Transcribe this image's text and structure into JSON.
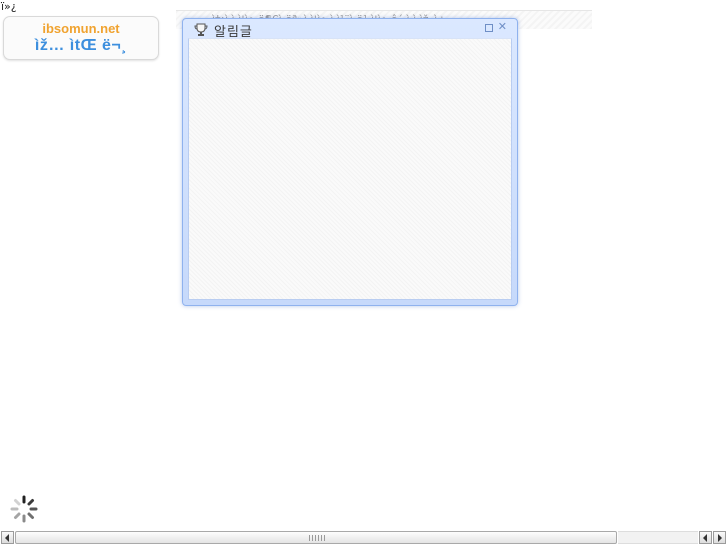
{
  "page": {
    "bom_text": "ï»¿"
  },
  "logo": {
    "site": "ibsomun.net",
    "subtitle": "ìž… ìtŒ ë¬¸"
  },
  "ticker": {
    "text": "ì†¡ì ì  ì¦ì•  ë¶€ì  ëª»ì  ì¦ì•  ì  ì¹¨ì  ë¹ ì¦ì•  ê´ ì  ì  ìž„ì±…"
  },
  "dialog": {
    "title": "알림글",
    "icon": "trophy-icon",
    "restore_icon": "restore-icon",
    "close_icon": "close-icon",
    "close_glyph": "✕",
    "border_color": "#8fb2ee"
  },
  "loading": {
    "icon": "loading-spinner-icon"
  },
  "colors": {
    "logo_site": "#f0a330",
    "logo_subtitle": "#3d8fde"
  }
}
